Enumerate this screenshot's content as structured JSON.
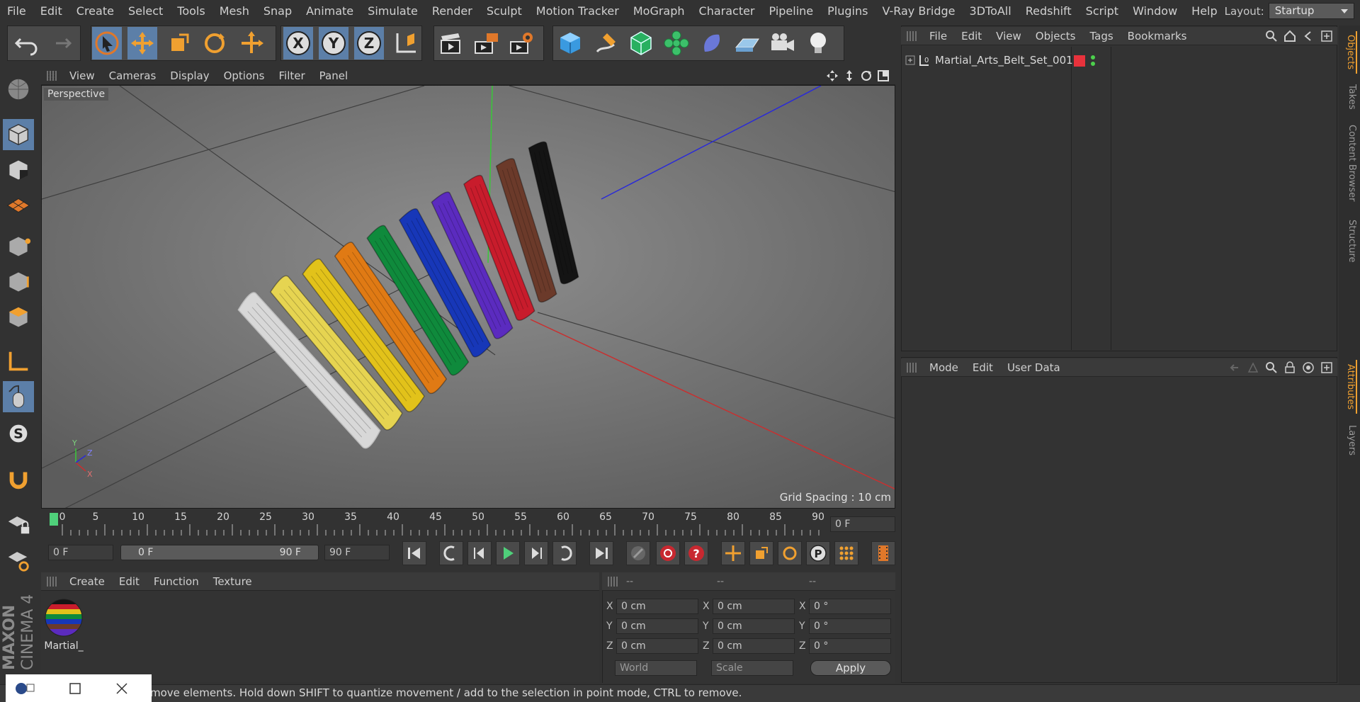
{
  "menubar": {
    "items": [
      "File",
      "Edit",
      "Create",
      "Select",
      "Tools",
      "Mesh",
      "Snap",
      "Animate",
      "Simulate",
      "Render",
      "Sculpt",
      "Motion Tracker",
      "MoGraph",
      "Character",
      "Pipeline",
      "Plugins",
      "V-Ray Bridge",
      "3DToAll",
      "Redshift",
      "Script",
      "Window",
      "Help"
    ],
    "layout_label": "Layout:",
    "layout_value": "Startup"
  },
  "toolbar": {
    "axis_x": "X",
    "axis_y": "Y",
    "axis_z": "Z"
  },
  "viewport": {
    "menu": [
      "View",
      "Cameras",
      "Display",
      "Options",
      "Filter",
      "Panel"
    ],
    "camera_label": "Perspective",
    "grid_spacing": "Grid Spacing : 10 cm",
    "axis_x": "X",
    "axis_y": "Y",
    "axis_z": "Z"
  },
  "belts": [
    {
      "color": "#d8d8d8"
    },
    {
      "color": "#e6d451"
    },
    {
      "color": "#e2c21a"
    },
    {
      "color": "#e07a14"
    },
    {
      "color": "#0f8a3c"
    },
    {
      "color": "#1737b8"
    },
    {
      "color": "#5b2bbf"
    },
    {
      "color": "#c81c2c"
    },
    {
      "color": "#6b3a2a"
    },
    {
      "color": "#141414"
    }
  ],
  "timeline": {
    "ticks": [
      "0",
      "5",
      "10",
      "15",
      "20",
      "25",
      "30",
      "35",
      "40",
      "45",
      "50",
      "55",
      "60",
      "65",
      "70",
      "75",
      "80",
      "85",
      "90"
    ],
    "current_frame": "0 F",
    "start_frame": "0 F",
    "range_start": "0 F",
    "range_end": "90 F",
    "end_frame": "90 F"
  },
  "materials": {
    "menu": [
      "Create",
      "Edit",
      "Function",
      "Texture"
    ],
    "item_label": "Martial_"
  },
  "coords": {
    "header": [
      "--",
      "--",
      "--"
    ],
    "rows": [
      {
        "a": "X",
        "av": "0 cm",
        "b": "X",
        "bv": "0 cm",
        "c": "X",
        "cv": "0 °"
      },
      {
        "a": "Y",
        "av": "0 cm",
        "b": "Y",
        "bv": "0 cm",
        "c": "Y",
        "cv": "0 °"
      },
      {
        "a": "Z",
        "av": "0 cm",
        "b": "Z",
        "bv": "0 cm",
        "c": "Z",
        "cv": "0 °"
      }
    ],
    "world": "World",
    "scale": "Scale",
    "apply": "Apply"
  },
  "objects": {
    "menu": [
      "File",
      "Edit",
      "View",
      "Objects",
      "Tags",
      "Bookmarks"
    ],
    "item": "Martial_Arts_Belt_Set_001",
    "colors": {
      "tag": "#e8323c",
      "dot": "#4cd04c"
    }
  },
  "attributes": {
    "menu": [
      "Mode",
      "Edit",
      "User Data"
    ]
  },
  "side_tabs": [
    "Objects",
    "Takes",
    "Content Browser",
    "Structure",
    "Attributes",
    "Layers"
  ],
  "brand": {
    "maxon": "MAXON",
    "product": "CINEMA 4D"
  },
  "status": {
    "text": "move elements. Hold down SHIFT to quantize movement / add to the selection in point mode, CTRL to remove."
  }
}
